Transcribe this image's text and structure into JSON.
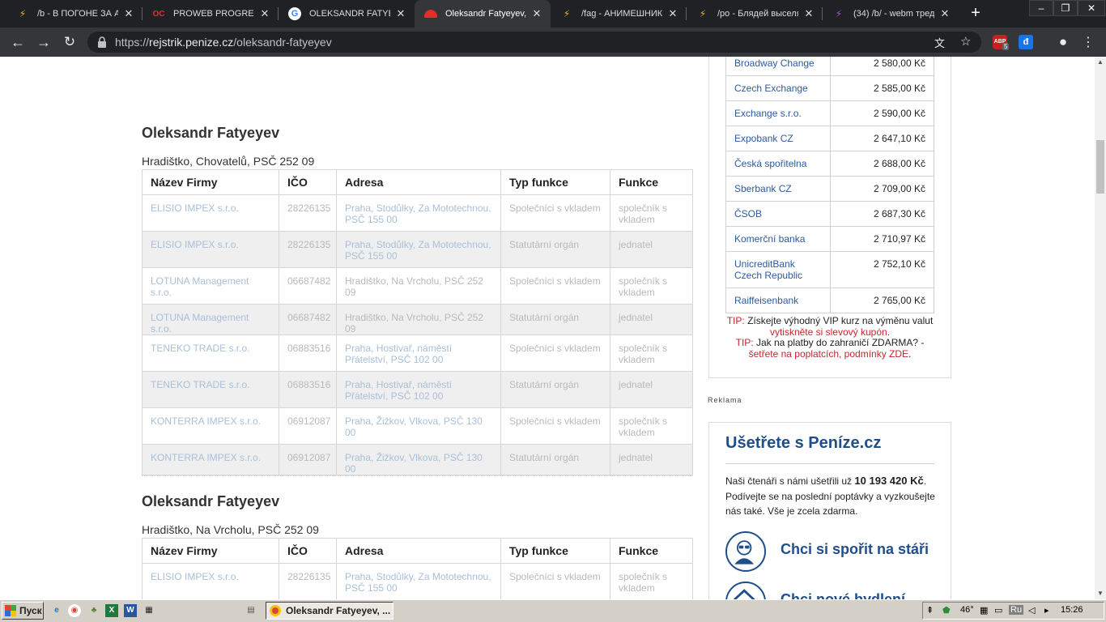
{
  "browser": {
    "tabs": [
      {
        "title": "/b - В ПОГОНЕ ЗА АН",
        "icon": "lightning-icon",
        "active": false
      },
      {
        "title": "PROWEB PROGRESSI",
        "icon": "oc-icon",
        "active": false
      },
      {
        "title": "OLEKSANDR FATYEYE",
        "icon": "google-icon",
        "active": false
      },
      {
        "title": "Oleksandr Fatyeyev,",
        "icon": "red-cloud-icon",
        "active": true
      },
      {
        "title": "/fag - АНИМЕШНИК,",
        "icon": "lightning-icon",
        "active": false
      },
      {
        "title": "/po - Блядей выселя",
        "icon": "lightning-icon",
        "active": false
      },
      {
        "title": "(34) /b/ - webm тред",
        "icon": "purple-lightning-icon",
        "active": false
      }
    ],
    "url_scheme": "https://",
    "url_host": "rejstrik.penize.cz",
    "url_path": "/oleksandr-fatyeyev",
    "abp_badge": "5"
  },
  "headers": {
    "firma": "Název Firmy",
    "ico": "IČO",
    "adresa": "Adresa",
    "typ": "Typ funkce",
    "funkce": "Funkce"
  },
  "person1": {
    "name": "Oleksandr Fatyeyev",
    "address": "Hradištko, Chovatelů, PSČ 252 09",
    "rows": [
      {
        "firma": "ELISIO IMPEX s.r.o.",
        "ico": "28226135",
        "adresa": "Praha, Stodůlky, Za Mototechnou, PSČ 155 00",
        "typ": "Společníci s vkladem",
        "funkce": "společník s vkladem"
      },
      {
        "firma": "ELISIO IMPEX s.r.o.",
        "ico": "28226135",
        "adresa": "Praha, Stodůlky, Za Mototechnou, PSČ 155 00",
        "typ": "Statutární orgán",
        "funkce": "jednatel"
      },
      {
        "firma": "LOTUNA Management s.r.o.",
        "ico": "06687482",
        "adresa": "Hradištko, Na Vrcholu, PSČ 252 09",
        "typ": "Společníci s vkladem",
        "funkce": "společník s vkladem"
      },
      {
        "firma": "LOTUNA Management s.r.o.",
        "ico": "06687482",
        "adresa": "Hradištko, Na Vrcholu, PSČ 252 09",
        "typ": "Statutární orgán",
        "funkce": "jednatel"
      },
      {
        "firma": "TENEKO TRADE s.r.o.",
        "ico": "06883516",
        "adresa": "Praha, Hostivař, náměstí Přátelství, PSČ 102 00",
        "typ": "Společníci s vkladem",
        "funkce": "společník s vkladem"
      },
      {
        "firma": "TENEKO TRADE s.r.o.",
        "ico": "06883516",
        "adresa": "Praha, Hostivař, náměstí Přátelství, PSČ 102 00",
        "typ": "Statutární orgán",
        "funkce": "jednatel"
      },
      {
        "firma": "KONTERRA IMPEX s.r.o.",
        "ico": "06912087",
        "adresa": "Praha, Žižkov, Vlkova, PSČ 130 00",
        "typ": "Společníci s vkladem",
        "funkce": "společník s vkladem"
      },
      {
        "firma": "KONTERRA IMPEX s.r.o.",
        "ico": "06912087",
        "adresa": "Praha, Žižkov, Vlkova, PSČ 130 00",
        "typ": "Statutární orgán",
        "funkce": "jednatel"
      }
    ]
  },
  "person2": {
    "name": "Oleksandr Fatyeyev",
    "address": "Hradištko, Na Vrcholu, PSČ 252 09",
    "rows": [
      {
        "firma": "ELISIO IMPEX s.r.o.",
        "ico": "28226135",
        "adresa": "Praha, Stodůlky, Za Mototechnou, PSČ 155 00",
        "typ": "Společníci s vkladem",
        "funkce": "společník s vkladem"
      }
    ]
  },
  "rates": [
    {
      "bank": "Broadway Change",
      "value": "2 580,00 Kč"
    },
    {
      "bank": "Czech Exchange",
      "value": "2 585,00 Kč"
    },
    {
      "bank": "Exchange s.r.o.",
      "value": "2 590,00 Kč"
    },
    {
      "bank": "Expobank CZ",
      "value": "2 647,10 Kč"
    },
    {
      "bank": "Česká spořitelna",
      "value": "2 688,00 Kč"
    },
    {
      "bank": "Sberbank CZ",
      "value": "2 709,00 Kč"
    },
    {
      "bank": "ČSOB",
      "value": "2 687,30 Kč"
    },
    {
      "bank": "Komerční banka",
      "value": "2 710,97 Kč"
    },
    {
      "bank": "UnicreditBank Czech Republic",
      "value": "2 752,10 Kč"
    },
    {
      "bank": "Raiffeisenbank",
      "value": "2 765,00 Kč"
    }
  ],
  "tips": {
    "tip1_label": "TIP:",
    "tip1_text": "Získejte výhodný VIP kurz na výměnu valut",
    "tip1_link": "vytiskněte si slevový kupón",
    "tip1_end": ".",
    "tip2_label": "TIP:",
    "tip2_text": "Jak na platby do zahraničí ZDARMA? -",
    "tip2_link": "šetřete na poplatcích, podmínky ZDE",
    "tip2_end": "."
  },
  "reklama": "Reklama",
  "savings": {
    "title": "Ušetřete s Peníze.cz",
    "text_before": "Naši čtenáři s námi ušetřili už",
    "amount": "10 193 420 Kč",
    "text_after": ". Podívejte se na poslední poptávky a vyzkoušejte nás také. Vše je zcela zdarma.",
    "cta1": "Chci si spořit na stáři",
    "cta2": "Chci nové bydlení"
  },
  "taskbar": {
    "start_label": "Пуск",
    "task_label": "Oleksandr Fatyeyev, ...",
    "temperature": "46°",
    "lang": "Ru",
    "clock": "15:26"
  },
  "colors": {
    "accent_blue": "#1f4e8c",
    "link_blue": "#2c5aa0",
    "tip_red": "#c0282e",
    "chrome_dark": "#202124"
  }
}
